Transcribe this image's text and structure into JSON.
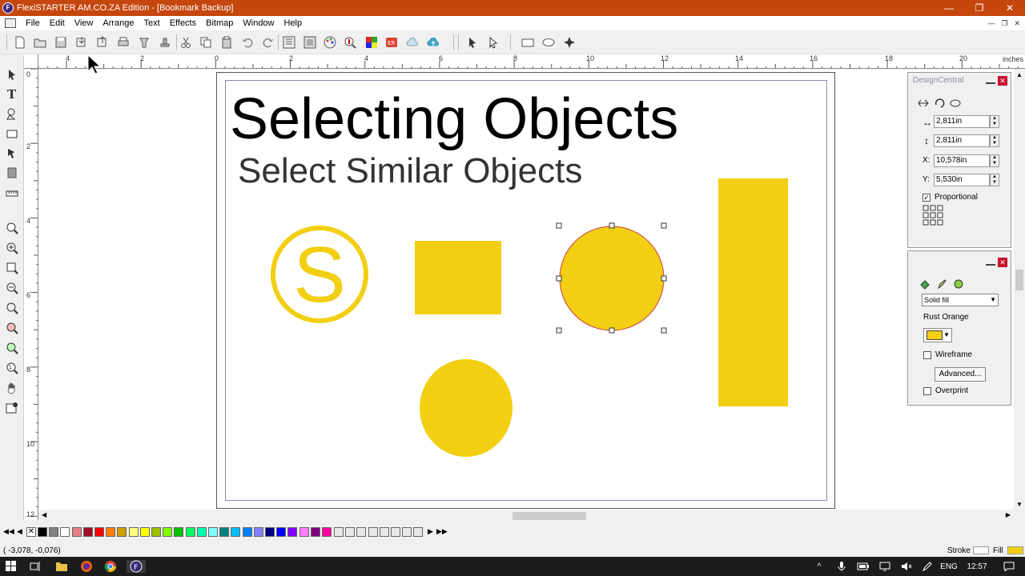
{
  "window": {
    "title": "FlexiSTARTER AM.CO.ZA Edition - [Bookmark Backup]",
    "app_icon": "flexi-app-icon",
    "controls": {
      "minimize": "—",
      "maximize": "❐",
      "close": "✕"
    }
  },
  "menu": {
    "items": [
      "File",
      "Edit",
      "View",
      "Arrange",
      "Text",
      "Effects",
      "Bitmap",
      "Window",
      "Help"
    ],
    "mdi_controls": {
      "minimize": "—",
      "restore": "❐",
      "close": "✕"
    }
  },
  "ruler": {
    "units": "inches",
    "h_labels": [
      "4",
      "2",
      "0",
      "2",
      "4",
      "6",
      "8",
      "10",
      "12",
      "14",
      "16",
      "18",
      "20"
    ],
    "v_labels": [
      "0",
      "2",
      "4",
      "6",
      "8",
      "10",
      "12"
    ]
  },
  "canvas": {
    "heading": "Selecting Objects",
    "subheading": "Select Similar Objects",
    "shape_color": "#f2cf13",
    "selection_outline_color": "#d23b3b"
  },
  "design_central": {
    "title": "DesignCentral",
    "width": "2,811in",
    "height": "2,811in",
    "x": "10,578in",
    "y": "5,530in",
    "x_label": "X:",
    "y_label": "Y:",
    "proportional_label": "Proportional",
    "proportional_checked": true
  },
  "fill_panel": {
    "fill_type": "Solid fill",
    "color_name": "Rust Orange",
    "color_swatch": "#f2cf13",
    "wireframe_label": "Wireframe",
    "advanced_label": "Advanced...",
    "overprint_label": "Overprint"
  },
  "palette": {
    "colors": [
      "#000000",
      "#808080",
      "#ffffff",
      "#e8808a",
      "#a0102a",
      "#ff0000",
      "#ff8000",
      "#d0a000",
      "#ffff80",
      "#ffff00",
      "#a0c000",
      "#80ff00",
      "#00c000",
      "#00ff60",
      "#00ffb0",
      "#80ffff",
      "#008080",
      "#00c0ff",
      "#0080ff",
      "#8080ff",
      "#000080",
      "#0000ff",
      "#8000ff",
      "#ff80ff",
      "#800080",
      "#ff00a0"
    ]
  },
  "status": {
    "coords": "( -3,078,   -0,076)",
    "stroke_label": "Stroke",
    "fill_label": "Fill"
  },
  "taskbar": {
    "time": "12:57",
    "lang": "ENG"
  }
}
